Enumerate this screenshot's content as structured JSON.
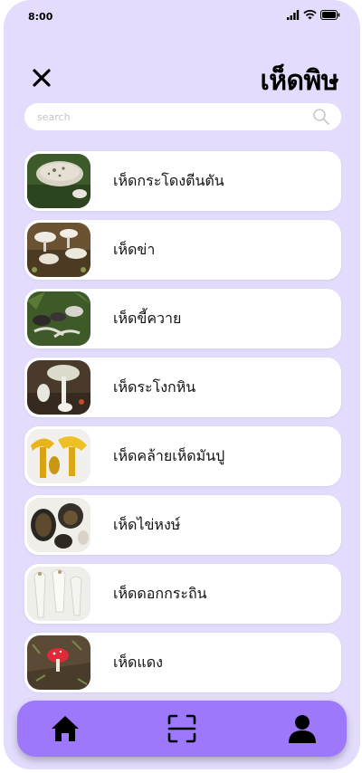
{
  "status_bar": {
    "time": "8:00"
  },
  "header": {
    "title": "เห็ดพิษ"
  },
  "search": {
    "placeholder": "search",
    "value": ""
  },
  "list": {
    "items": [
      {
        "label": "เห็ดกระโดงตีนตัน"
      },
      {
        "label": "เห็ดข่า"
      },
      {
        "label": "เห็ดขี้ควาย"
      },
      {
        "label": "เห็ดระโงกหิน"
      },
      {
        "label": "เห็ดคล้ายเห็ดมันปู"
      },
      {
        "label": "เห็ดไข่หงษ์"
      },
      {
        "label": "เห็ดดอกกระถิน"
      },
      {
        "label": "เห็ดแดง"
      }
    ]
  },
  "bottom_nav": {
    "items": [
      "home-icon",
      "scan-icon",
      "profile-icon"
    ]
  },
  "colors": {
    "background": "#e3dcfd",
    "nav": "#9e78fa",
    "card": "#ffffff"
  }
}
